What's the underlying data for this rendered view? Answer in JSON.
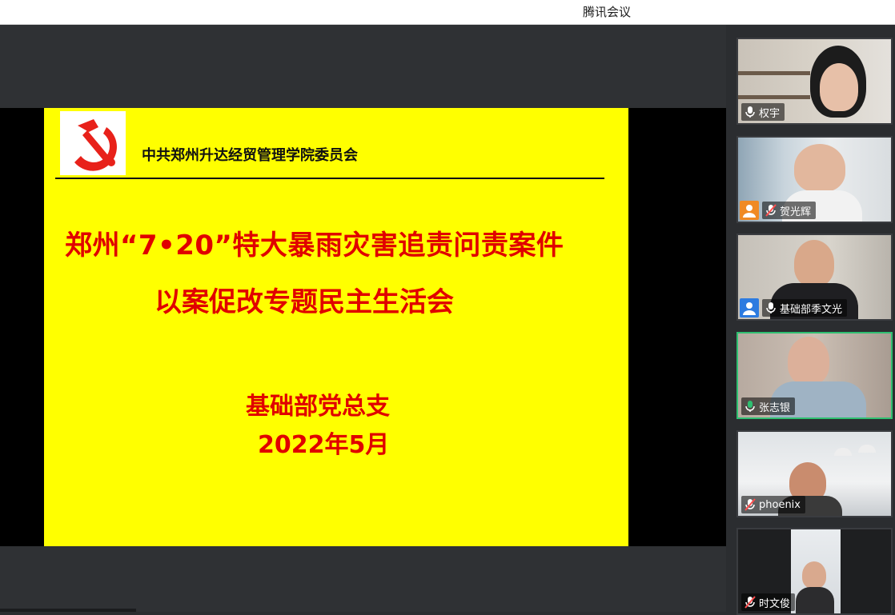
{
  "window": {
    "title": "腾讯会议"
  },
  "slide": {
    "org_name": "中共郑州升达经贸管理学院委员会",
    "headline_line1": "郑州“7•20”特大暴雨灾害追责问责案件",
    "headline_line2": "以案促改专题民主生活会",
    "department": "基础部党总支",
    "date": "2022年5月"
  },
  "participants": [
    {
      "name": "权宇",
      "mic": "on",
      "badge": "none",
      "active": false
    },
    {
      "name": "贺光辉",
      "mic": "muted",
      "badge": "orange",
      "active": false
    },
    {
      "name": "基础部季文光",
      "mic": "on",
      "badge": "blue",
      "active": false
    },
    {
      "name": "张志银",
      "mic": "on",
      "badge": "none",
      "active": true
    },
    {
      "name": "phoenix",
      "mic": "muted",
      "badge": "none",
      "active": false
    },
    {
      "name": "时文俊",
      "mic": "muted",
      "badge": "none",
      "active": false
    }
  ],
  "colors": {
    "slide_bg": "#ffff00",
    "headline": "#e00000",
    "active_speaker_border": "#2fbf71",
    "badge_orange": "#f08a24",
    "badge_blue": "#2d7be0"
  }
}
